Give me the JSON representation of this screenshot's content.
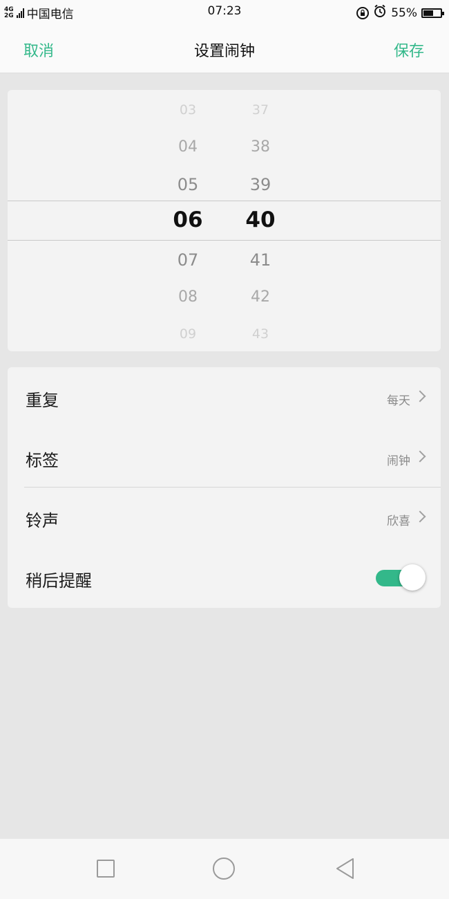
{
  "status_bar": {
    "network_top": "4G",
    "network_bottom": "2G",
    "carrier": "中国电信",
    "time": "07:23",
    "battery": "55%",
    "battery_level": 0.55
  },
  "header": {
    "cancel_label": "取消",
    "title": "设置闹钟",
    "save_label": "保存"
  },
  "time_picker": {
    "hours": [
      "03",
      "04",
      "05",
      "06",
      "07",
      "08",
      "09"
    ],
    "minutes": [
      "37",
      "38",
      "39",
      "40",
      "41",
      "42",
      "43"
    ],
    "selected_hour": "06",
    "selected_minute": "40"
  },
  "settings": {
    "repeat": {
      "label": "重复",
      "value": "每天"
    },
    "label": {
      "label": "标签",
      "value": "闹钟"
    },
    "ringtone": {
      "label": "铃声",
      "value": "欣喜"
    },
    "snooze": {
      "label": "稍后提醒",
      "enabled": true
    }
  },
  "colors": {
    "accent": "#33b88a",
    "background": "#e6e6e6",
    "card": "#f3f3f3"
  },
  "icons": [
    "lock-rotation-icon",
    "alarm-icon",
    "battery-icon",
    "chevron-right-icon",
    "nav-recents-icon",
    "nav-home-icon",
    "nav-back-icon"
  ]
}
